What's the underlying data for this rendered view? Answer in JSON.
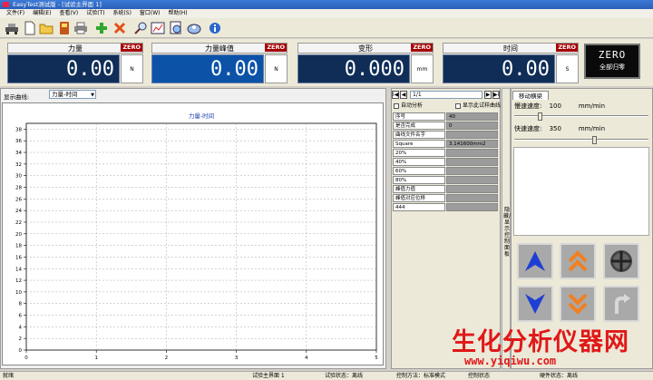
{
  "window": {
    "title": "EasyTest测试版 - [试验主界面 1]"
  },
  "menu": [
    "文件(F)",
    "编辑(E)",
    "查看(V)",
    "试验(T)",
    "系统(S)",
    "窗口(W)",
    "帮助(H)"
  ],
  "toolbar": {
    "icons": [
      "machine-icon",
      "new-doc-icon",
      "open-folder-icon",
      "save-icon",
      "print-icon",
      "plus-icon",
      "delete-icon",
      "search-icon",
      "chart-icon",
      "report-icon",
      "settings-icon",
      "info-icon"
    ]
  },
  "displays": [
    {
      "label": "力量",
      "value": "0.00",
      "unit": "N",
      "zero": "ZERO"
    },
    {
      "label": "力量峰值",
      "value": "0.00",
      "unit": "N",
      "zero": "ZERO"
    },
    {
      "label": "变形",
      "value": "0.000",
      "unit": "mm",
      "zero": "ZERO"
    },
    {
      "label": "时间",
      "value": "0.00",
      "unit": "S",
      "zero": "ZERO"
    }
  ],
  "zero_all": {
    "top": "ZERO",
    "bottom": "全部归零"
  },
  "curve": {
    "label": "显示曲线:",
    "selected": "力量-时间"
  },
  "chart_data": {
    "type": "line",
    "title": "力量-时间",
    "xlabel": "",
    "ylabel": "",
    "xlim": [
      0,
      5
    ],
    "ylim": [
      0,
      39
    ],
    "x_ticks": [
      0,
      1,
      2,
      3,
      4,
      5
    ],
    "y_ticks": [
      0,
      2,
      4,
      6,
      8,
      10,
      12,
      14,
      16,
      18,
      20,
      22,
      24,
      26,
      28,
      30,
      32,
      34,
      36,
      38
    ],
    "grid": true,
    "series": []
  },
  "nav": {
    "page": "1/1",
    "first": "I◀",
    "prev": "◀",
    "next": "▶",
    "last": "▶I"
  },
  "options": {
    "auto_analysis": "自动分析",
    "show_curve": "显示此试样曲线"
  },
  "results": [
    {
      "label": "序号",
      "value": "40"
    },
    {
      "label": "是否完成",
      "value": "0"
    },
    {
      "label": "曲线文件名字",
      "value": ""
    },
    {
      "label": "Square",
      "value": "3.141600mm2"
    },
    {
      "label": "20%",
      "value": ""
    },
    {
      "label": "40%",
      "value": ""
    },
    {
      "label": "60%",
      "value": ""
    },
    {
      "label": "80%",
      "value": ""
    },
    {
      "label": "峰值力值",
      "value": ""
    },
    {
      "label": "峰值对应位移",
      "value": ""
    },
    {
      "label": "444",
      "value": ""
    }
  ],
  "side_strip": "隐藏/显示控制面板",
  "jog": {
    "tab": "移动横梁",
    "slow_label": "慢速速度:",
    "slow_value": "100",
    "slow_unit": "mm/min",
    "slow_fraction": 0.18,
    "fast_label": "快速速度:",
    "fast_value": "350",
    "fast_unit": "mm/min",
    "fast_fraction": 0.6
  },
  "status": {
    "ready": "就绪",
    "page": "试验主界面 1",
    "test_state": "试验状态：离线",
    "control_mode": "控制方法：标准模式",
    "control_state": "控制状态",
    "hw_state": "硬件状态：离线"
  },
  "watermark": {
    "line1": "生化分析仪器网",
    "line2": "www.yiqiwu.com"
  },
  "colors": {
    "display_bg": "#0f2d57",
    "display_highlight": "#0c53a8",
    "zero_red": "#a40000",
    "jog_blue": "#1f3fd4",
    "jog_orange": "#f08020",
    "watermark_red": "#e01818"
  }
}
